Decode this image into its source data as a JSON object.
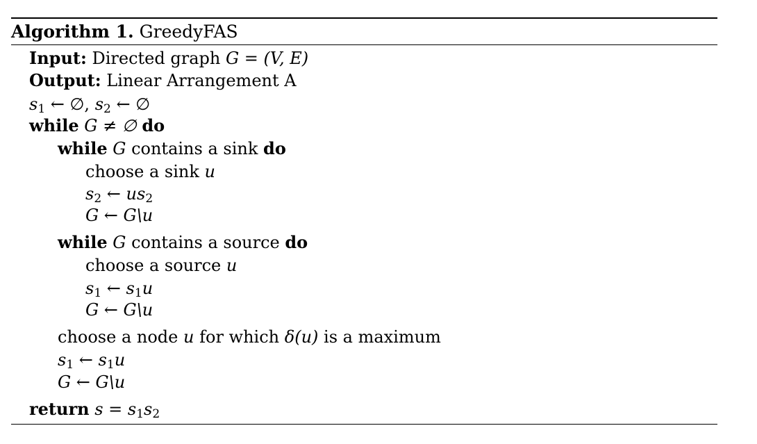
{
  "algorithm": {
    "caption_label": "Algorithm 1.",
    "caption_title": "GreedyFAS",
    "input_label": "Input:",
    "input_text": "Directed graph",
    "input_math": "G = (V, E)",
    "output_label": "Output:",
    "output_text": "Linear Arrangement A",
    "init_s1": "s",
    "init_arrow_empty": " ← ∅, ",
    "init_s2": "s",
    "init_arrow_empty2": " ← ∅",
    "kw_while": "while",
    "kw_do": "do",
    "kw_return": "return",
    "outer_cond": "G ≠ ∅",
    "sink_loop_G": "G",
    "sink_loop_text": "contains a sink",
    "choose_sink_text": "choose a sink",
    "var_u": "u",
    "sink_assign_lhs": "s",
    "sink_assign_arrow": " ← ",
    "sink_assign_rhs_u": "us",
    "remove_G": "G ← G\\u",
    "source_loop_G": "G",
    "source_loop_text": "contains a source",
    "choose_source_text": "choose a source",
    "source_assign_lhs": "s",
    "source_assign_arrow": " ← ",
    "source_assign_rhs": "s",
    "choose_node_text": "choose a node",
    "choose_node_for": "for which",
    "choose_node_delta": "δ(u)",
    "choose_node_tail": "is a maximum",
    "return_lhs": "s",
    "return_eq": " = ",
    "return_rhs1": "s",
    "return_rhs2": "s",
    "sub_1": "1",
    "sub_2": "2"
  }
}
